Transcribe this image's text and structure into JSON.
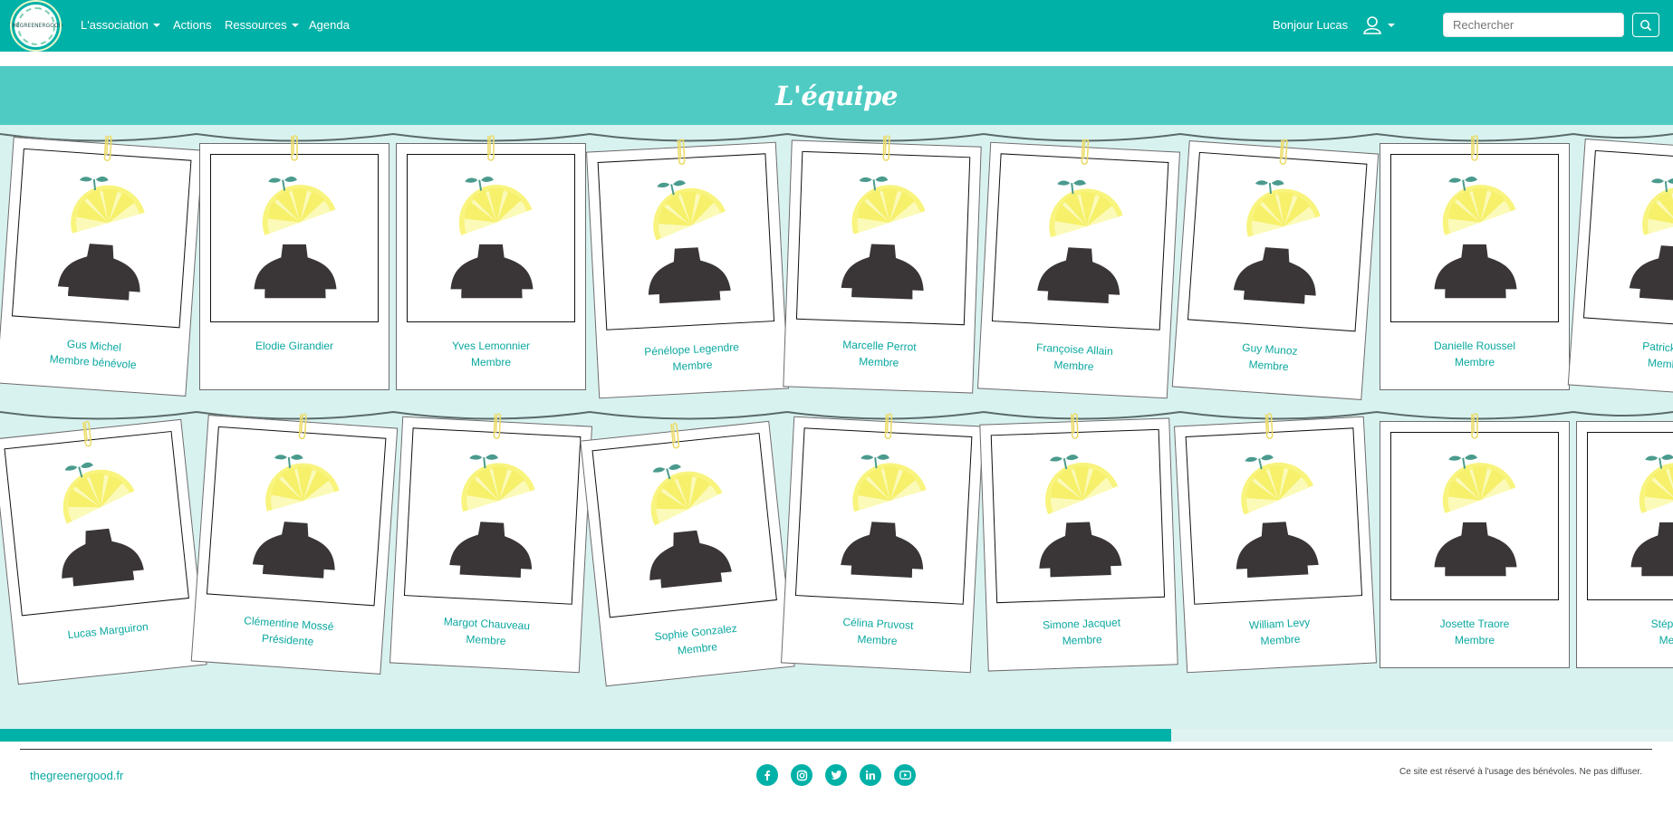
{
  "header": {
    "logo_text": [
      "THE",
      "GREENER",
      "GOOD"
    ],
    "nav": [
      {
        "label": "L'association",
        "dropdown": true
      },
      {
        "label": "Actions",
        "dropdown": false
      },
      {
        "label": "Ressources",
        "dropdown": true
      },
      {
        "label": "Agenda",
        "dropdown": false
      }
    ],
    "greeting": "Bonjour Lucas",
    "search_placeholder": "Rechercher"
  },
  "page": {
    "title": "L'équipe"
  },
  "members": [
    [
      {
        "name": "Gus Michel",
        "role": "Membre bénévole"
      },
      {
        "name": "Elodie Girandier",
        "role": ""
      },
      {
        "name": "Yves Lemonnier",
        "role": "Membre"
      },
      {
        "name": "Pénélope Legendre",
        "role": "Membre"
      },
      {
        "name": "Marcelle Perrot",
        "role": "Membre"
      },
      {
        "name": "Françoise Allain",
        "role": "Membre"
      },
      {
        "name": "Guy Munoz",
        "role": "Membre"
      },
      {
        "name": "Danielle Roussel",
        "role": "Membre"
      },
      {
        "name": "Patrick Cl",
        "role": "Membr"
      }
    ],
    [
      {
        "name": "Lucas Marguiron",
        "role": ""
      },
      {
        "name": "Clémentine Mossé",
        "role": "Présidente"
      },
      {
        "name": "Margot Chauveau",
        "role": "Membre"
      },
      {
        "name": "Sophie Gonzalez",
        "role": "Membre"
      },
      {
        "name": "Célina Pruvost",
        "role": "Membre"
      },
      {
        "name": "Simone Jacquet",
        "role": "Membre"
      },
      {
        "name": "William Levy",
        "role": "Membre"
      },
      {
        "name": "Josette Traore",
        "role": "Membre"
      },
      {
        "name": "Stéphan",
        "role": "Mem"
      }
    ]
  ],
  "scroll": {
    "position_fraction": 0.7
  },
  "footer": {
    "site_link": "thegreenergood.fr",
    "socials": [
      "facebook-icon",
      "instagram-icon",
      "twitter-icon",
      "linkedin-icon",
      "youtube-icon"
    ],
    "notice": "Ce site est réservé à l'usage des bénévoles. Ne pas diffuser."
  },
  "colors": {
    "primary": "#00b1a7",
    "banner": "#4fcbc3",
    "team_bg": "#d8f2f0",
    "text_accent": "#0aa8a0"
  }
}
